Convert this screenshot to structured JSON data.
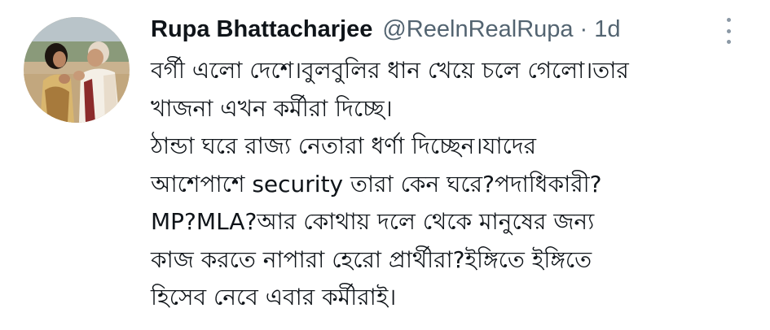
{
  "tweet": {
    "display_name": "Rupa Bhattacharjee",
    "handle": "@ReelnRealRupa",
    "separator": "·",
    "time": "1d",
    "text_lines": [
      "বর্গী এলো দেশে।বুলবুলির ধান খেয়ে চলে গেলো।তার",
      "খাজনা এখন কর্মীরা দিচ্ছে।",
      "ঠান্ডা ঘরে রাজ্য নেতারা ধর্ণা দিচ্ছেন।যাদের",
      "আশেপাশে security তারা কেন ঘরে?পদাধিকারী?",
      "MP?MLA?আর কোথায় দলে থেকে মানুষের জন্য",
      "কাজ করতে নাপারা হেরো প্রার্থীরা?ইঙ্গিতে ইঙ্গিতে",
      "হিসেব নেবে এবার কর্মীরাই।"
    ]
  },
  "icons": {
    "avatar": "profile-photo",
    "more": "more-vertical-icon"
  },
  "colors": {
    "text": "#0f1419",
    "secondary": "#536471"
  }
}
